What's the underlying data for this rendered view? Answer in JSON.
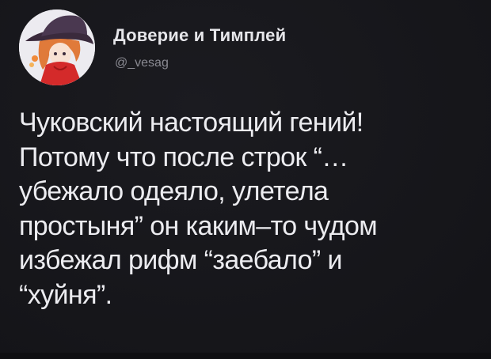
{
  "tweet": {
    "author_name": "Доверие и Тимплей",
    "author_handle": "@_vesag",
    "text": "Чуковский настоящий гений!\nПотому что после строк “…\nубежало одеяло, улетела\nпростыня” он каким–то чудом\nизбежал рифм “заебало” и\n“хуйня”."
  },
  "colors": {
    "background": "#151519",
    "text": "#ececf0",
    "handle": "#8a8a92"
  }
}
